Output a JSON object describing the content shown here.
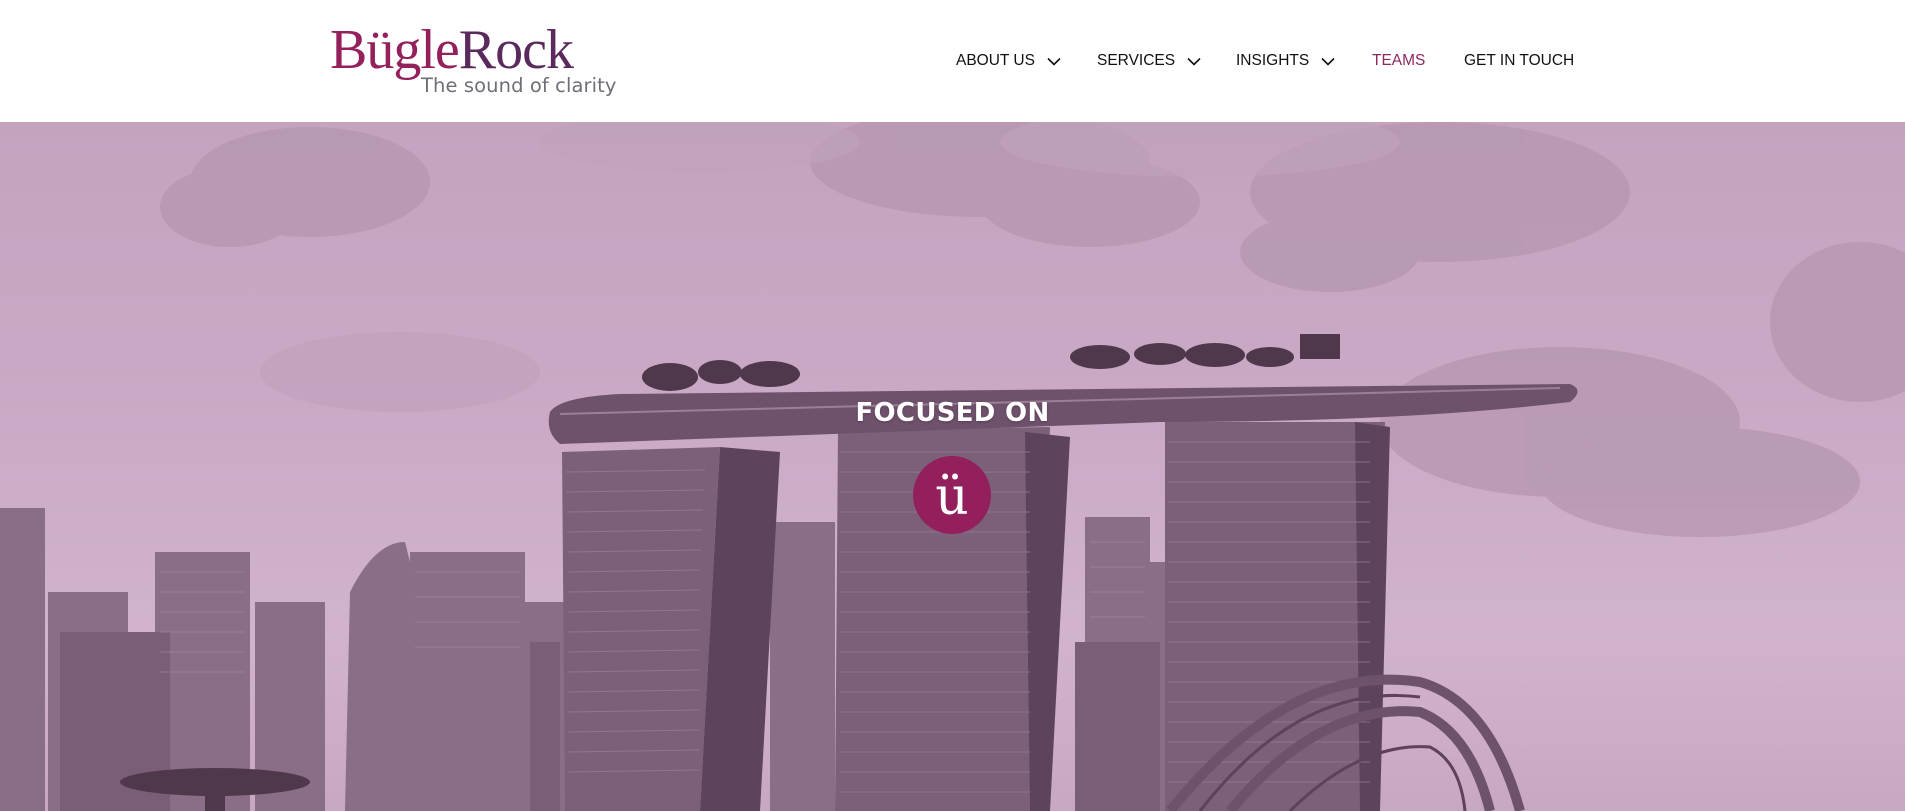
{
  "header": {
    "logo": {
      "part1": "Bügle",
      "part2": "Rock",
      "tagline": "The sound of clarity"
    },
    "nav": [
      {
        "label": "ABOUT US",
        "dropdown": true,
        "active": false
      },
      {
        "label": "SERVICES",
        "dropdown": true,
        "active": false
      },
      {
        "label": "INSIGHTS",
        "dropdown": true,
        "active": false
      },
      {
        "label": "TEAMS",
        "dropdown": false,
        "active": true
      },
      {
        "label": "GET IN TOUCH",
        "dropdown": false,
        "active": false
      }
    ]
  },
  "hero": {
    "title": "FOCUSED ON",
    "badge_glyph": "ü",
    "background": "Singapore skyline (Marina Bay Sands) with purple tint"
  },
  "colors": {
    "brand": "#94205c",
    "brand_dark": "#5a2a5c",
    "active_nav": "#8b2a62",
    "hero_tint": "#c9a9c5"
  }
}
